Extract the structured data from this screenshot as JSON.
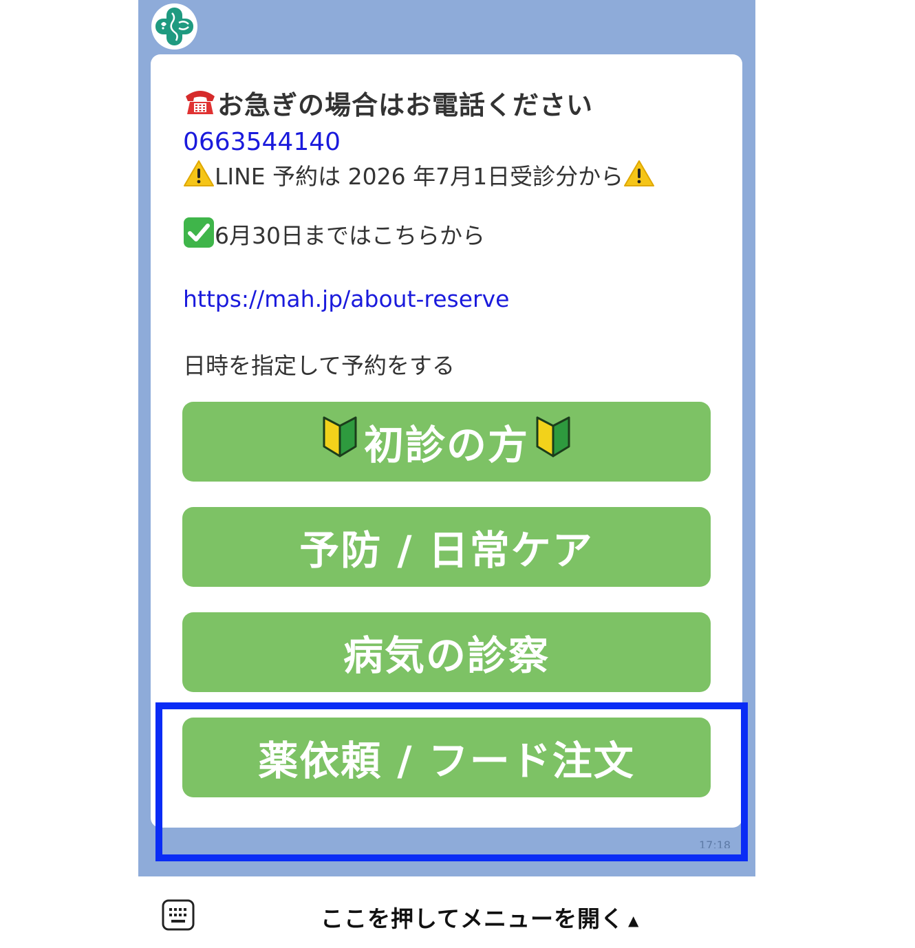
{
  "chat": {
    "avatar_icon": "clinic-logo-icon",
    "message": {
      "heading": "お急ぎの場合はお電話ください",
      "phone": "0663544140",
      "notice": "LINE 予約は 2026 年7月1日受診分から",
      "until": "6月30日まではこちらから",
      "url": "https://mah.jp/about-reserve",
      "instruction": "日時を指定して予約をする"
    },
    "buttons": {
      "first_visit": "初診の方",
      "prevention": "予防 / 日常ケア",
      "illness": "病気の診察",
      "medicine_food": "薬依頼 / フード注文"
    },
    "timestamp": "17:18"
  },
  "menu": {
    "open_label": "ここを押してメニューを開く",
    "arrow": "▲"
  },
  "colors": {
    "chat_background": "#8eabd9",
    "button_green": "#7dc265",
    "link_blue": "#1a1adc",
    "highlight_blue": "#0a2cf5",
    "logo_green": "#1f9a80"
  }
}
